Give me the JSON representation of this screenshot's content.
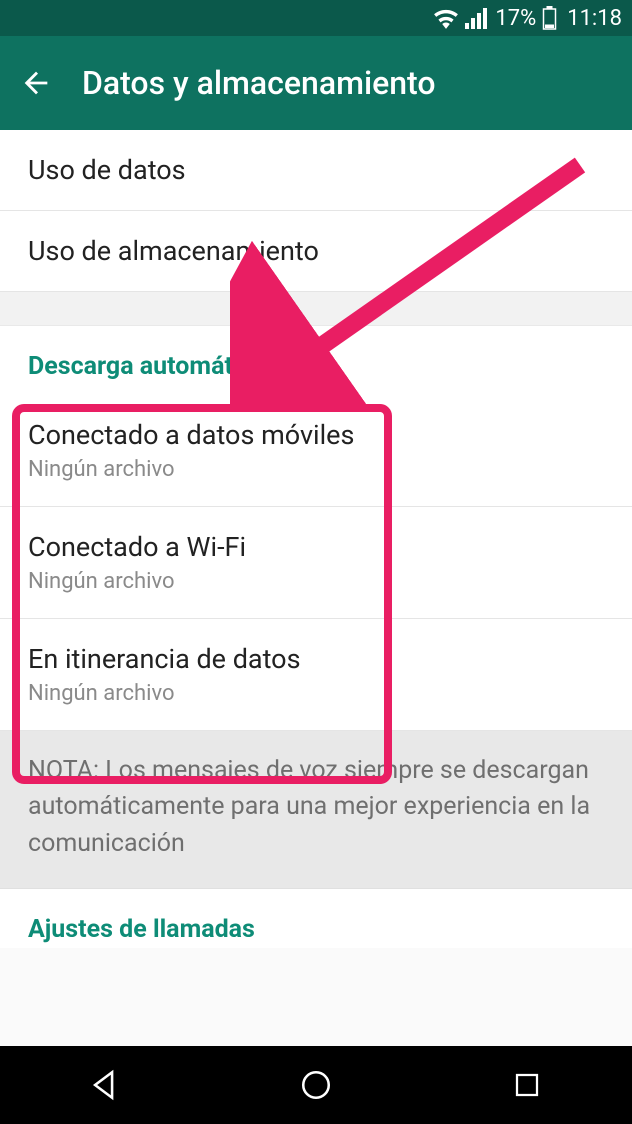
{
  "status_bar": {
    "battery_pct": "17%",
    "time": "11:18"
  },
  "app_bar": {
    "title": "Datos y almacenamiento"
  },
  "rows": {
    "data_usage": "Uso de datos",
    "storage_usage": "Uso de almacenamiento"
  },
  "sections": {
    "auto_download": "Descarga automática",
    "call_settings": "Ajustes de llamadas"
  },
  "auto_items": [
    {
      "title": "Conectado a datos móviles",
      "sub": "Ningún archivo"
    },
    {
      "title": "Conectado a Wi-Fi",
      "sub": "Ningún archivo"
    },
    {
      "title": "En itinerancia de datos",
      "sub": "Ningún archivo"
    }
  ],
  "note": "NOTA: Los mensajes de voz siempre se descargan automáticamente para una mejor experiencia en la comunicación"
}
